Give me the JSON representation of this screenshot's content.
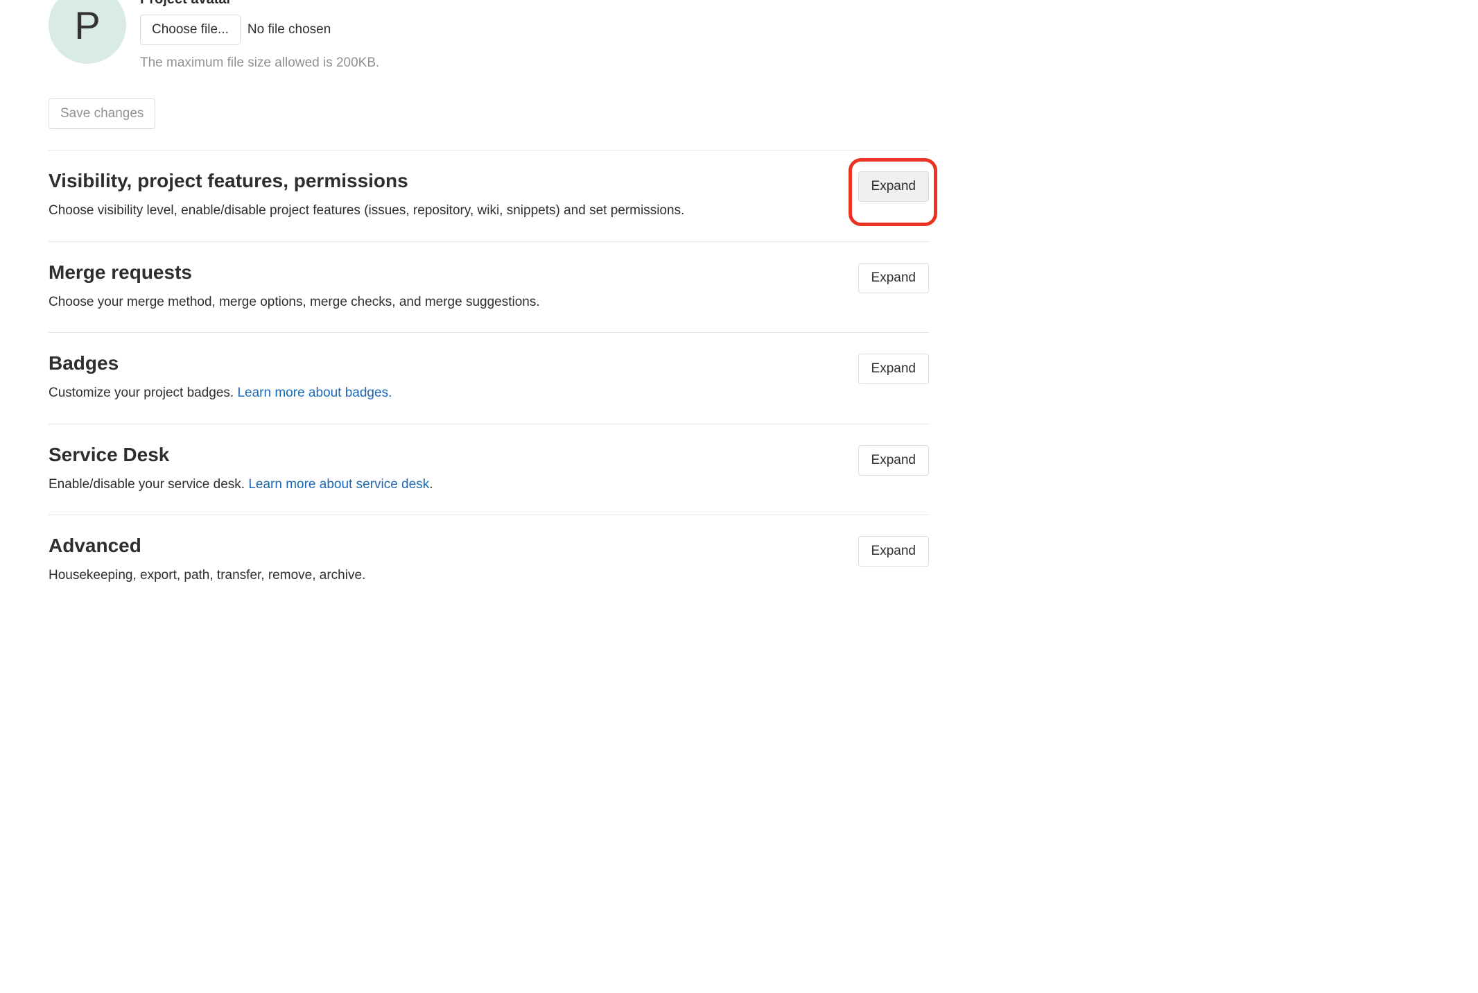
{
  "avatar": {
    "letter": "P",
    "label": "Project avatar",
    "choose_file": "Choose file...",
    "no_file": "No file chosen",
    "hint": "The maximum file size allowed is 200KB."
  },
  "save_changes": "Save changes",
  "sections": {
    "visibility": {
      "title": "Visibility, project features, permissions",
      "desc": "Choose visibility level, enable/disable project features (issues, repository, wiki, snippets) and set permissions.",
      "expand": "Expand"
    },
    "merge": {
      "title": "Merge requests",
      "desc": "Choose your merge method, merge options, merge checks, and merge suggestions.",
      "expand": "Expand"
    },
    "badges": {
      "title": "Badges",
      "desc_pre": "Customize your project badges. ",
      "link": "Learn more about badges.",
      "expand": "Expand"
    },
    "service": {
      "title": "Service Desk",
      "desc_pre": "Enable/disable your service desk. ",
      "link": "Learn more about service desk",
      "desc_post": ".",
      "expand": "Expand"
    },
    "advanced": {
      "title": "Advanced",
      "desc": "Housekeeping, export, path, transfer, remove, archive.",
      "expand": "Expand"
    }
  }
}
